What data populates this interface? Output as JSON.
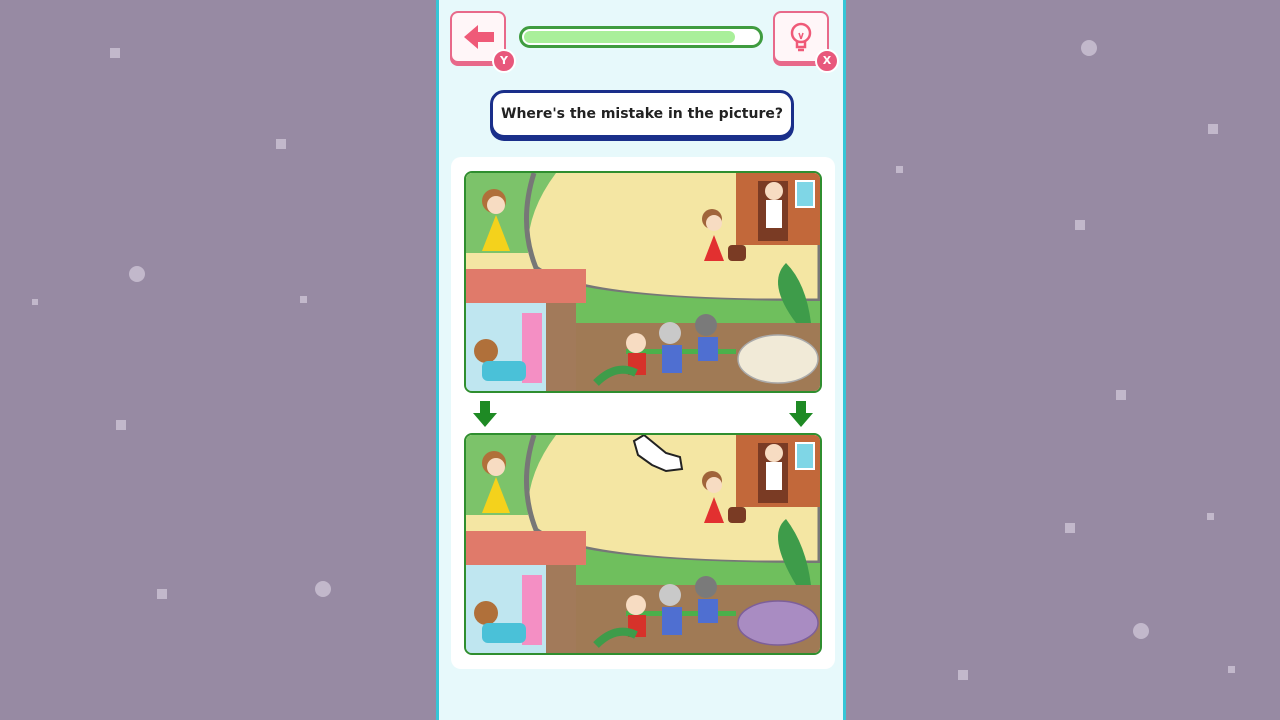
{
  "header": {
    "back_badge": "Y",
    "hint_badge": "X",
    "progress_fraction": 0.9
  },
  "question": "Where's the mistake in the picture?",
  "icons": {
    "back": "back-arrow-icon",
    "hint": "lightbulb-icon",
    "down_arrows": "down-arrow-icon",
    "pointer": "hand-pointer-icon"
  },
  "colors": {
    "accent_pink": "#e8698a",
    "progress_green": "#a9ef9a",
    "question_border": "#1a2f8a",
    "turnip_original": "#f1ead7",
    "turnip_changed": "#a98cc2"
  }
}
